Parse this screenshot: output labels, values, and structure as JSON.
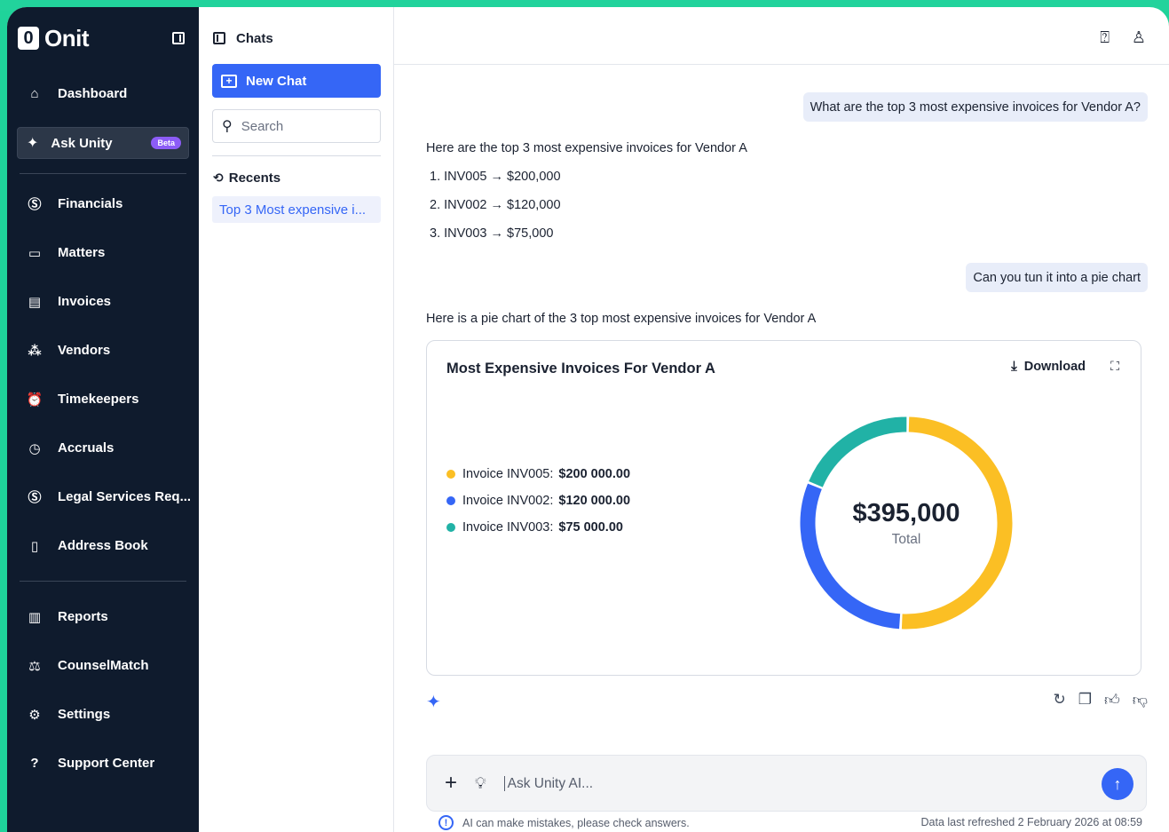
{
  "brand": {
    "name": "Onit"
  },
  "sidebar": {
    "dashboard": "Dashboard",
    "ask_unity": {
      "label": "Ask Unity",
      "badge": "Beta"
    },
    "items": [
      {
        "label": "Financials",
        "icon": "dollar-circle-icon"
      },
      {
        "label": "Matters",
        "icon": "folder-icon"
      },
      {
        "label": "Invoices",
        "icon": "document-icon"
      },
      {
        "label": "Vendors",
        "icon": "people-icon"
      },
      {
        "label": "Timekeepers",
        "icon": "alarm-clock-icon"
      },
      {
        "label": "Accruals",
        "icon": "clock-icon"
      },
      {
        "label": "Legal Services Req...",
        "icon": "dollar-circle-icon"
      },
      {
        "label": "Address Book",
        "icon": "book-icon"
      }
    ],
    "bottom_items": [
      {
        "label": "Reports",
        "icon": "bar-chart-icon"
      },
      {
        "label": "CounselMatch",
        "icon": "gavel-icon"
      },
      {
        "label": "Settings",
        "icon": "gear-icon"
      },
      {
        "label": "Support Center",
        "icon": "help-icon"
      }
    ]
  },
  "chats": {
    "title": "Chats",
    "new_chat": "New Chat",
    "search_placeholder": "Search",
    "recents_label": "Recents",
    "recent_items": [
      "Top 3 Most expensive i..."
    ]
  },
  "conversation": {
    "q1": "What are the top 3 most expensive invoices for Vendor A?",
    "a1_intro": "Here are the top 3 most expensive invoices for Vendor A",
    "a1_list": [
      "1. INV005 → $200,000",
      "2. INV002 → $120,000",
      "3. INV003 → $75,000"
    ],
    "q2": "Can you tun it into a pie chart",
    "a2_intro": "Here is a pie chart of the 3 top most expensive invoices for Vendor A"
  },
  "chart_card": {
    "title": "Most Expensive Invoices For Vendor A",
    "download": "Download",
    "total_value": "$395,000",
    "total_label": "Total"
  },
  "chart_data": {
    "type": "pie",
    "title": "Most Expensive Invoices For Vendor A",
    "donut": true,
    "series": [
      {
        "name": "Invoice INV005:",
        "label": "$200 000.00",
        "value": 200000,
        "color": "#fbbf24"
      },
      {
        "name": "Invoice INV002:",
        "label": "$120 000.00",
        "value": 120000,
        "color": "#3566f6"
      },
      {
        "name": "Invoice INV003:",
        "label": "$75 000.00",
        "value": 75000,
        "color": "#21b2a6"
      }
    ],
    "total": 395000
  },
  "composer": {
    "placeholder": "Ask Unity AI...",
    "disclaimer": "AI can make mistakes, please check answers.",
    "refresh_note": "Data last refreshed 2 February 2026 at 08:59"
  }
}
